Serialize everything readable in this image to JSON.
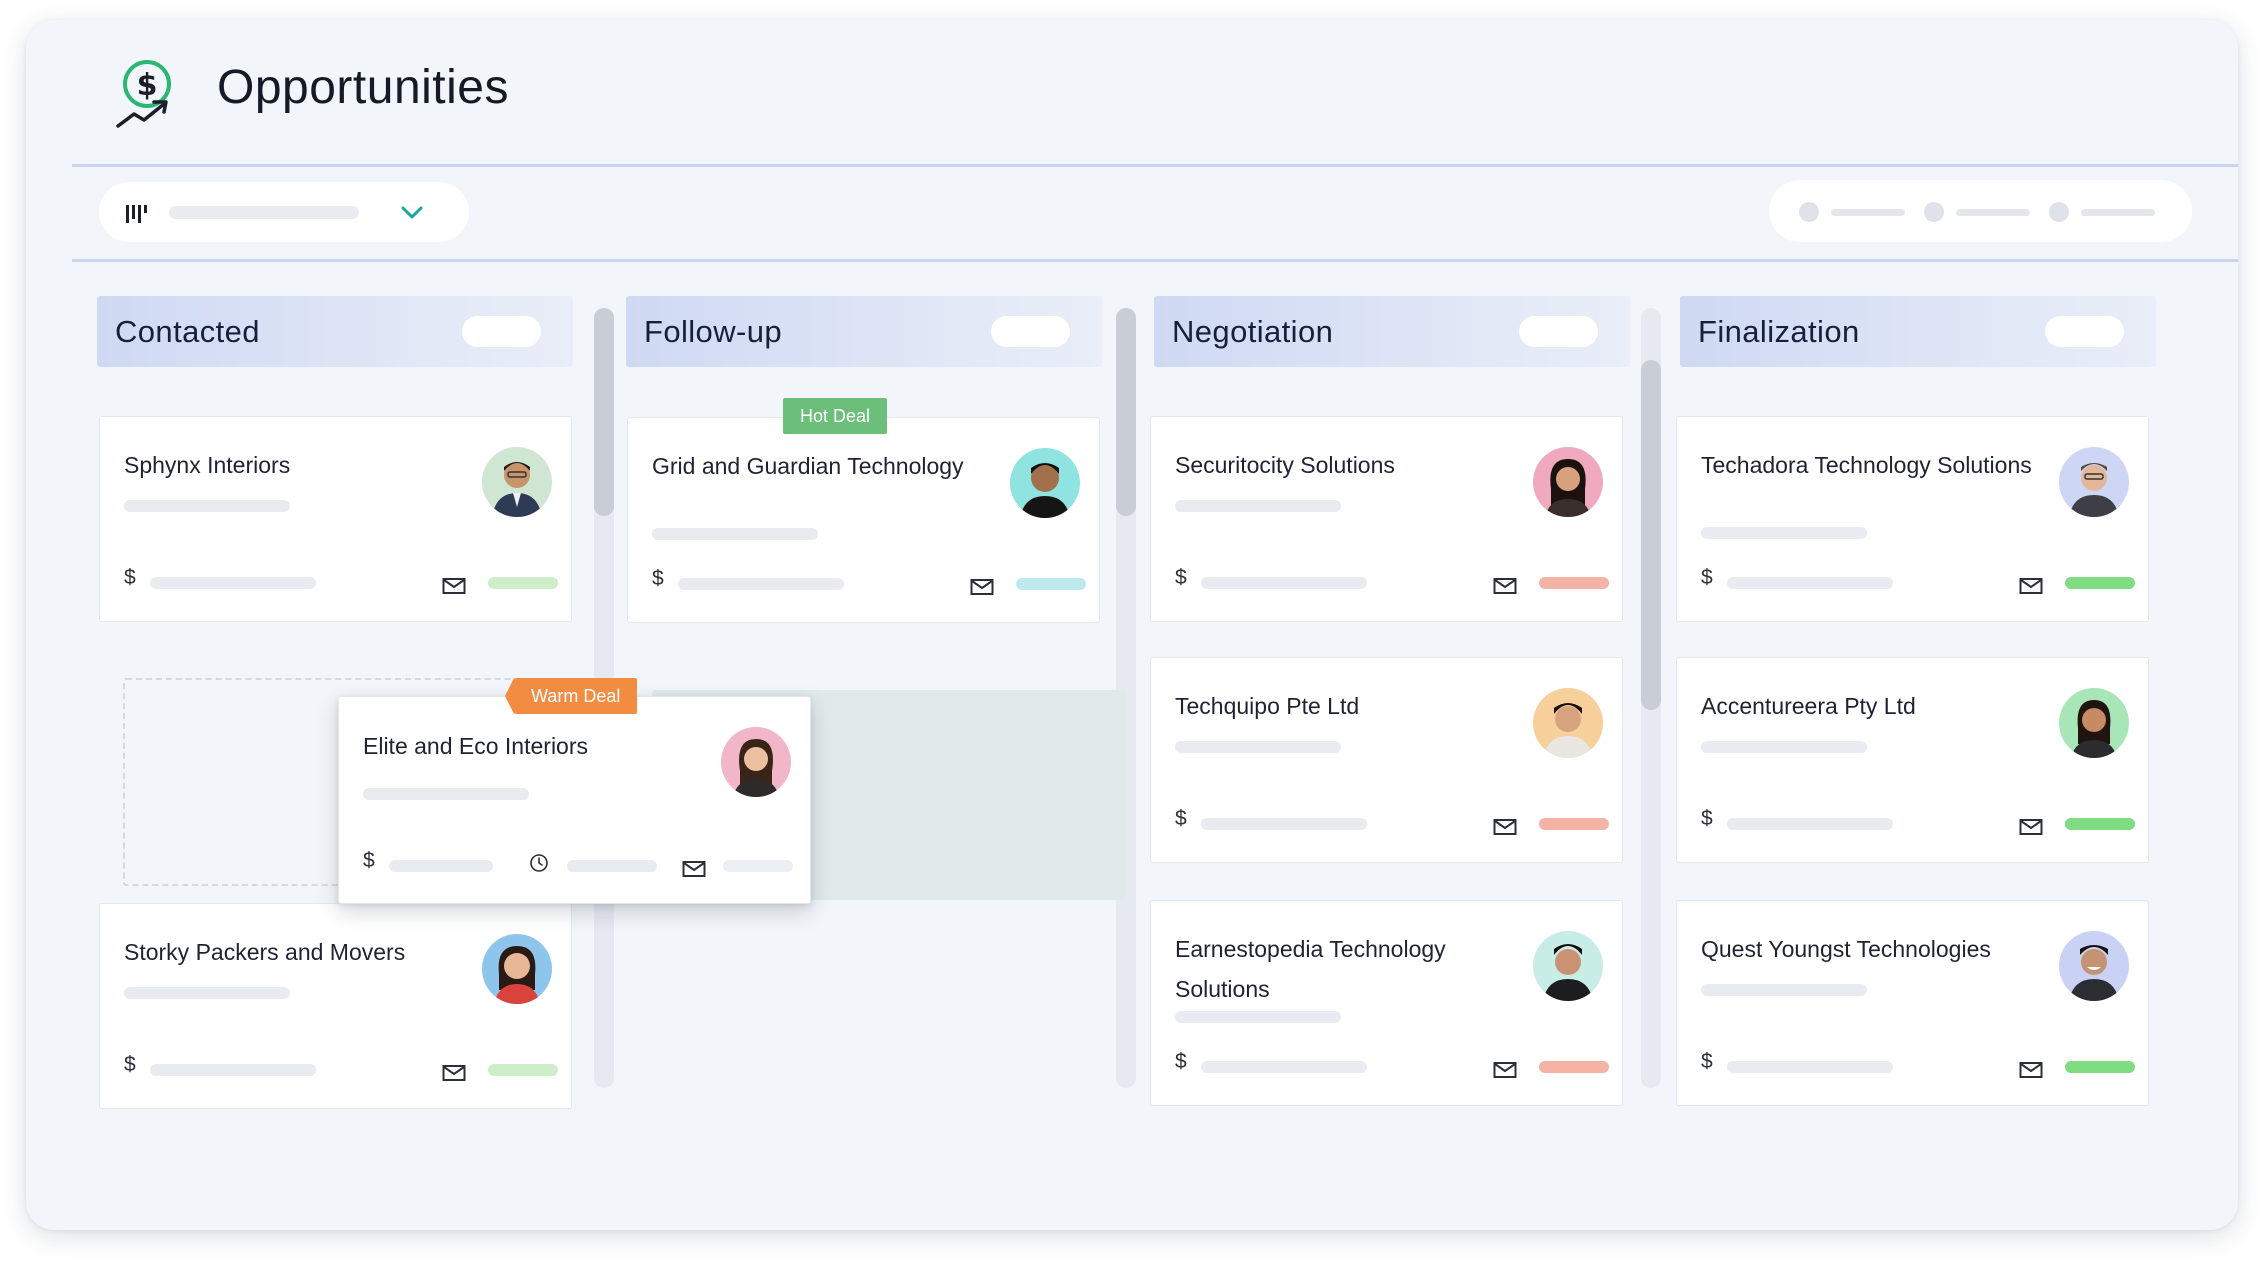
{
  "header": {
    "title": "Opportunities"
  },
  "icons": {
    "logo": "dollar-growth-icon",
    "board_view": "kanban-board-icon",
    "dropdown": "chevron-down-icon",
    "email": "mail-icon",
    "due": "clock-icon"
  },
  "columns": [
    {
      "title": "Contacted"
    },
    {
      "title": "Follow-up"
    },
    {
      "title": "Negotiation"
    },
    {
      "title": "Finalization"
    }
  ],
  "tags": {
    "hot": "Hot Deal",
    "warm": "Warm Deal"
  },
  "currency_symbol": "$",
  "cards": {
    "contacted": [
      {
        "name": "Sphynx Interiors",
        "status_color": "#cdeec9"
      },
      {
        "name": "Storky Packers and Movers",
        "status_color": "#cdeec9"
      }
    ],
    "dragging": {
      "name": "Elite and Eco Interiors"
    },
    "followup": [
      {
        "name": "Grid and Guardian Technology",
        "status_color": "#bfeaed"
      }
    ],
    "negotiation": [
      {
        "name": "Securitocity Solutions",
        "status_color": "#f5b3a5"
      },
      {
        "name": "Techquipo Pte Ltd",
        "status_color": "#f5b3a5"
      },
      {
        "name": "Earnestopedia Technology Solutions",
        "status_color": "#f5b3a5"
      }
    ],
    "finalization": [
      {
        "name": "Techadora Technology Solutions",
        "status_color": "#7fdc83"
      },
      {
        "name": "Accentureera Pty Ltd",
        "status_color": "#7fdc83"
      },
      {
        "name": "Quest Youngst Technologies",
        "status_color": "#7fdc83"
      }
    ]
  },
  "colors": {
    "accent_green": "#2bb673",
    "hot_tag": "#6cbf7a",
    "warm_tag": "#f28c43",
    "column_header": "#d6def4"
  }
}
